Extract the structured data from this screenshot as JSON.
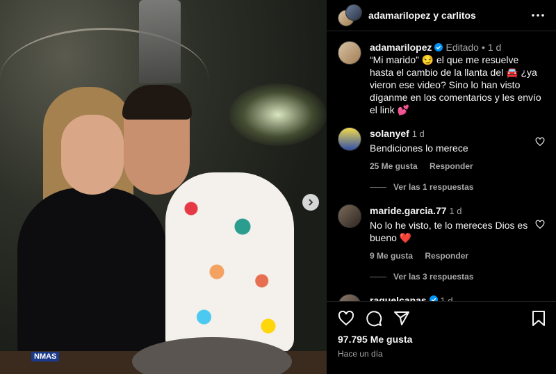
{
  "post": {
    "header": {
      "title": "adamarilopez y carlitos",
      "more_icon": "more-dots-icon"
    },
    "caption": {
      "username": "adamarilopez",
      "edited": "Editado",
      "dot": "•",
      "age": "1 d",
      "line1": "“Mi marido” 😏 el que me resuelve hasta el cambio de la llanta del 🚘 ¿ya vieron ese video? Sino lo han visto díganme en los comentarios y les envío el link 💕"
    },
    "comments": [
      {
        "username": "solanyef",
        "age": "1 d",
        "text": "Bendiciones lo merece",
        "likes": "25 Me gusta",
        "reply": "Responder",
        "replies": "Ver las 1 respuestas"
      },
      {
        "username": "maride.garcia.77",
        "age": "1 d",
        "text": "No lo he visto, te lo mereces Dios es bueno ❤️",
        "likes": "9 Me gusta",
        "reply": "Responder",
        "replies": "Ver las 3 respuestas"
      },
      {
        "username": "raquelcanas",
        "age": "1 d"
      }
    ],
    "stats": {
      "likes": "97.795 Me gusta",
      "time": "Hace un día"
    },
    "photo_overlay": {
      "mic_label": "NMAS"
    }
  },
  "colors": {
    "verified": "#0095f6",
    "bg": "#000000",
    "muted": "#a8a8a8"
  }
}
